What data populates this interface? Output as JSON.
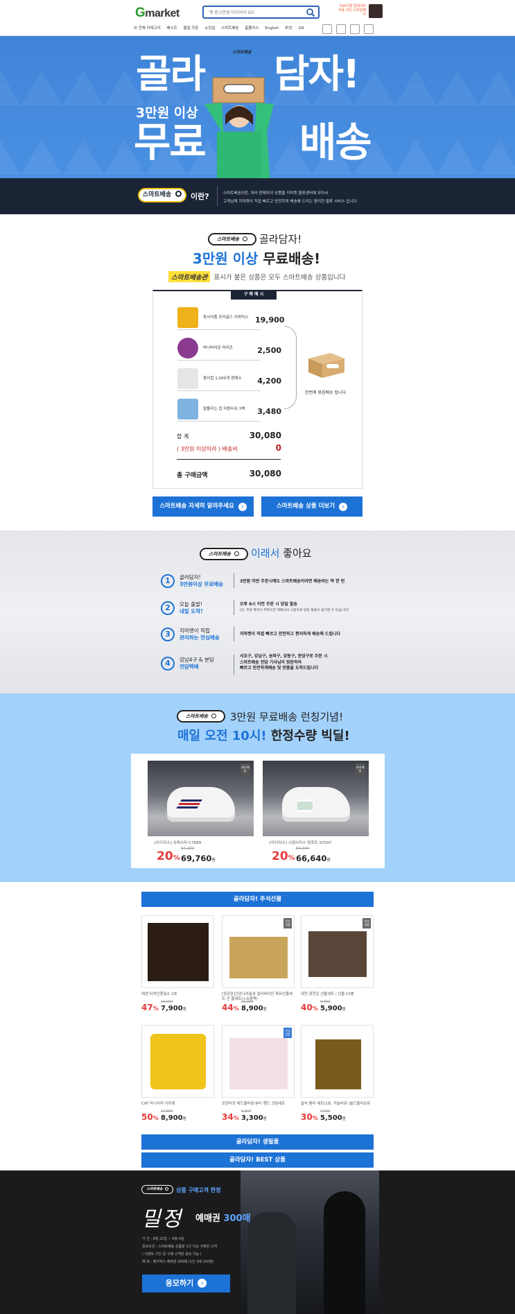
{
  "header": {
    "logo_g": "G",
    "logo_rest": "market",
    "search_placeholder": "엣 받고만큼 다이어리 GO",
    "promo_text": "와르디엘 업데이트 사용 코인 스마일페이",
    "categories_label": "전체 카테고리",
    "nav": [
      "베스트",
      "올킬·쿠폰",
      "쇼킹딜",
      "스마트배송",
      "홈플러스",
      "English",
      "中文",
      "G9"
    ],
    "icons": [
      "login-icon",
      "mypage-icon",
      "recent-icon",
      "cart-icon",
      "more-icon"
    ]
  },
  "hero": {
    "title_left": "골라",
    "title_right": "담자!",
    "sub": "3만원 이상",
    "big_left": "무료",
    "big_right": "배송",
    "box_label": "스마트배송",
    "bar_pill": "스마트배송",
    "bar_what": "이란?",
    "bar_line1": "스마트배송이란, 여러 판매자의 상품을 지마켓 물류센터에 모아서",
    "bar_line2": "고객님께 지마켓이 직접 빠르고 안전하게 배송해 드리는 편리한 물류 서비스 입니다"
  },
  "sec1": {
    "pill": "스마트배송",
    "title1": "골라담자!",
    "title2_blue": "3만원 이상",
    "title2_black": " 무료배송!",
    "tag": "스마트배송관",
    "desc": "표시가 붙은 상품은 모두 스마트배송 상품입니다",
    "example_tab": "구 매 예 시",
    "items": [
      {
        "name": "동서식품 모카골드 커피믹스",
        "price": "19,900"
      },
      {
        "name": "바나바라운 마리콘",
        "price": "2,500"
      },
      {
        "name": "종이컵 1,000개 판매소",
        "price": "4,200"
      },
      {
        "name": "잘풀리는 집 미용티슈 3팩",
        "price": "3,480"
      }
    ],
    "box_label": "한번에 묶음배송 됩니다",
    "subtotal_label": "합     계",
    "subtotal": "30,080",
    "ship_label": "( 3만원 이상이라 ) 배송비",
    "ship": "0",
    "total_label": "총 구매금액",
    "total": "30,080",
    "btn1": "스마트배송 자세히 알려주세요",
    "btn2": "스마트배송 상품 더보기",
    "arrow": "›"
  },
  "sec2": {
    "pill": "스마트배송",
    "title_blue": "이래서",
    "title_black": " 좋아요",
    "benefits": [
      {
        "num": "1",
        "t1": "골라담자!",
        "t2": "3만원이상 무료배송",
        "d1": "3만원 미만 주문시에도 스마트배송이라면 배송비는 딱 한 번",
        "d2": "",
        "d3": ""
      },
      {
        "num": "2",
        "t1": "오늘 출발!",
        "t2": "내일 도착!",
        "d1": "오후 6시 이전 주문 시 당일 발송",
        "d2": "(단, 주문 폭주나 부득이한 택배사의 사정으로 당일 발송이 불가할 수 있습니다)",
        "d3": ""
      },
      {
        "num": "3",
        "t1": "지마켓이 직접",
        "t2": "관리하는 안심배송",
        "d1": "지마켓이 직접 빠르고 안전하고 편리하게 배송해 드립니다",
        "d2": "",
        "d3": ""
      },
      {
        "num": "4",
        "t1": "강남4구 & 분당",
        "t2": "전담택배",
        "d1": "서초구, 강남구, 송파구, 강동구, 분당구로 주문 시",
        "d2": "스마트배송 전담 기사님이 방문하여",
        "d3": "빠르고 안전하게배송 및 반품을 도와드립니다"
      }
    ]
  },
  "sec3": {
    "pill": "스마트배송",
    "title1": "3만원 무료배송 런칭기념!",
    "title2_blue": "매일 오전 10시!",
    "title2_black": " 한정수량 빅딜!",
    "deals": [
      {
        "name": "[아디다스] 슈퍼스타 C7689",
        "orig": "87,200",
        "pct": "20",
        "price": "69,760",
        "badge": "국내 배송"
      },
      {
        "name": "[아디다스] 스탠스미스 컴포트 S7597",
        "orig": "83,300",
        "pct": "20",
        "price": "66,640",
        "badge": "국내 배송"
      }
    ]
  },
  "sec4": {
    "header": "골라담자! 추석선물",
    "products": [
      {
        "name": "에센 티처인헨질수 2호",
        "orig": "15,000",
        "pct": "47",
        "price": "7,900",
        "badge": ""
      },
      {
        "name": "[정관장]건강나라홍삼 컬러바이진 파워선물세트 선 물세트(+쇼핑백)",
        "orig": "16,000",
        "pct": "44",
        "price": "8,900",
        "badge": "추석 선물"
      },
      {
        "name": "대천 광천김 선물세트 / 선물 15봉",
        "orig": "9,900",
        "pct": "40",
        "price": "5,900",
        "badge": "추석 선물"
      },
      {
        "name": "CAT 미니어처 다이캐",
        "orig": "17,800",
        "pct": "50",
        "price": "8,900",
        "badge": ""
      },
      {
        "name": "포린타의 레드블라섬 뷰티 핸드 크림세트",
        "orig": "5,000",
        "pct": "34",
        "price": "3,300",
        "badge": "신규 상품"
      },
      {
        "name": "삶속 펜티 세트(2호, 카놀라유 /놀드올리브유",
        "orig": "7,900",
        "pct": "30",
        "price": "5,500",
        "badge": ""
      }
    ],
    "btn_daily": "골라담자! 생필품",
    "btn_best": "골라담자! BEST 상품"
  },
  "sec5": {
    "pill": "스마트배송",
    "top": "상품 구매고객 한정",
    "title": "밀정",
    "sub_black": "예매권 ",
    "sub_blue": "300매",
    "info1": "기     간 : 8월 22일 ~ 9월 4일",
    "info2": "응모조건 : 스마트배송 상품을 1건 이상 구매한 고객",
    "info3": "         ( 이벤트 기간 중 구매 고객만 응모 가능 )",
    "info4": "혜     택 : 메가박스 예매권 300매 (1인 2매 150명)",
    "btn": "응모하기",
    "arrow": "›"
  }
}
